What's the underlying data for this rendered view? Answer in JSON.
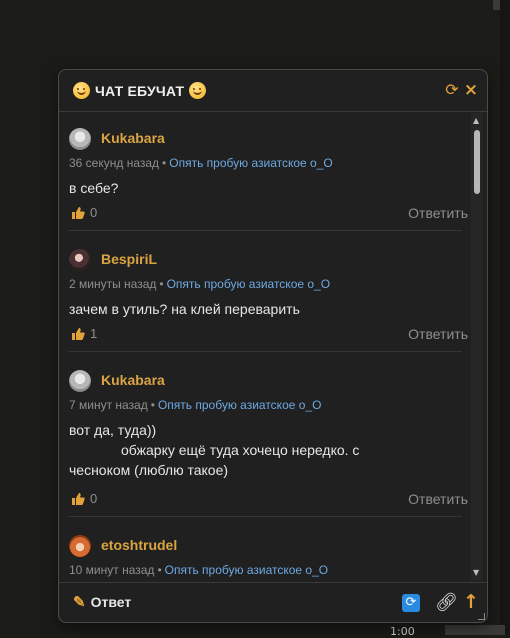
{
  "chat": {
    "title": "ЧАТ ЕБУЧАТ",
    "refresh_icon": "refresh-icon",
    "close_icon": "close-icon"
  },
  "messages": [
    {
      "author": "Kukabara",
      "time": "36 секунд назад",
      "topic": "Опять пробую азиатское о_О",
      "text_lines": [
        "в себе?"
      ],
      "likes": "0",
      "reply": "Ответить"
    },
    {
      "author": "BespiriL",
      "time": "2 минуты назад",
      "topic": "Опять пробую азиатское о_О",
      "text_lines": [
        "зачем в утиль? на клей переварить"
      ],
      "likes": "1",
      "reply": "Ответить"
    },
    {
      "author": "Kukabara",
      "time": "7 минут назад",
      "topic": "Опять пробую азиатское о_О",
      "text_lines": [
        "вот да, туда))",
        "обжарку ещё туда хочецо нередко. с",
        "чесноком (люблю такое)"
      ],
      "likes": "0",
      "reply": "Ответить"
    },
    {
      "author": "etoshtrudel",
      "time": "10 минут назад",
      "topic": "Опять пробую азиатское о_О"
    }
  ],
  "separator_dot": "•",
  "footer": {
    "answer_label": "Ответ",
    "refresh_icon": "refresh-icon",
    "link_icon": "link-icon",
    "scroll_top_icon": "arrow-up-icon"
  },
  "background": {
    "bottom_text": "1:00"
  }
}
